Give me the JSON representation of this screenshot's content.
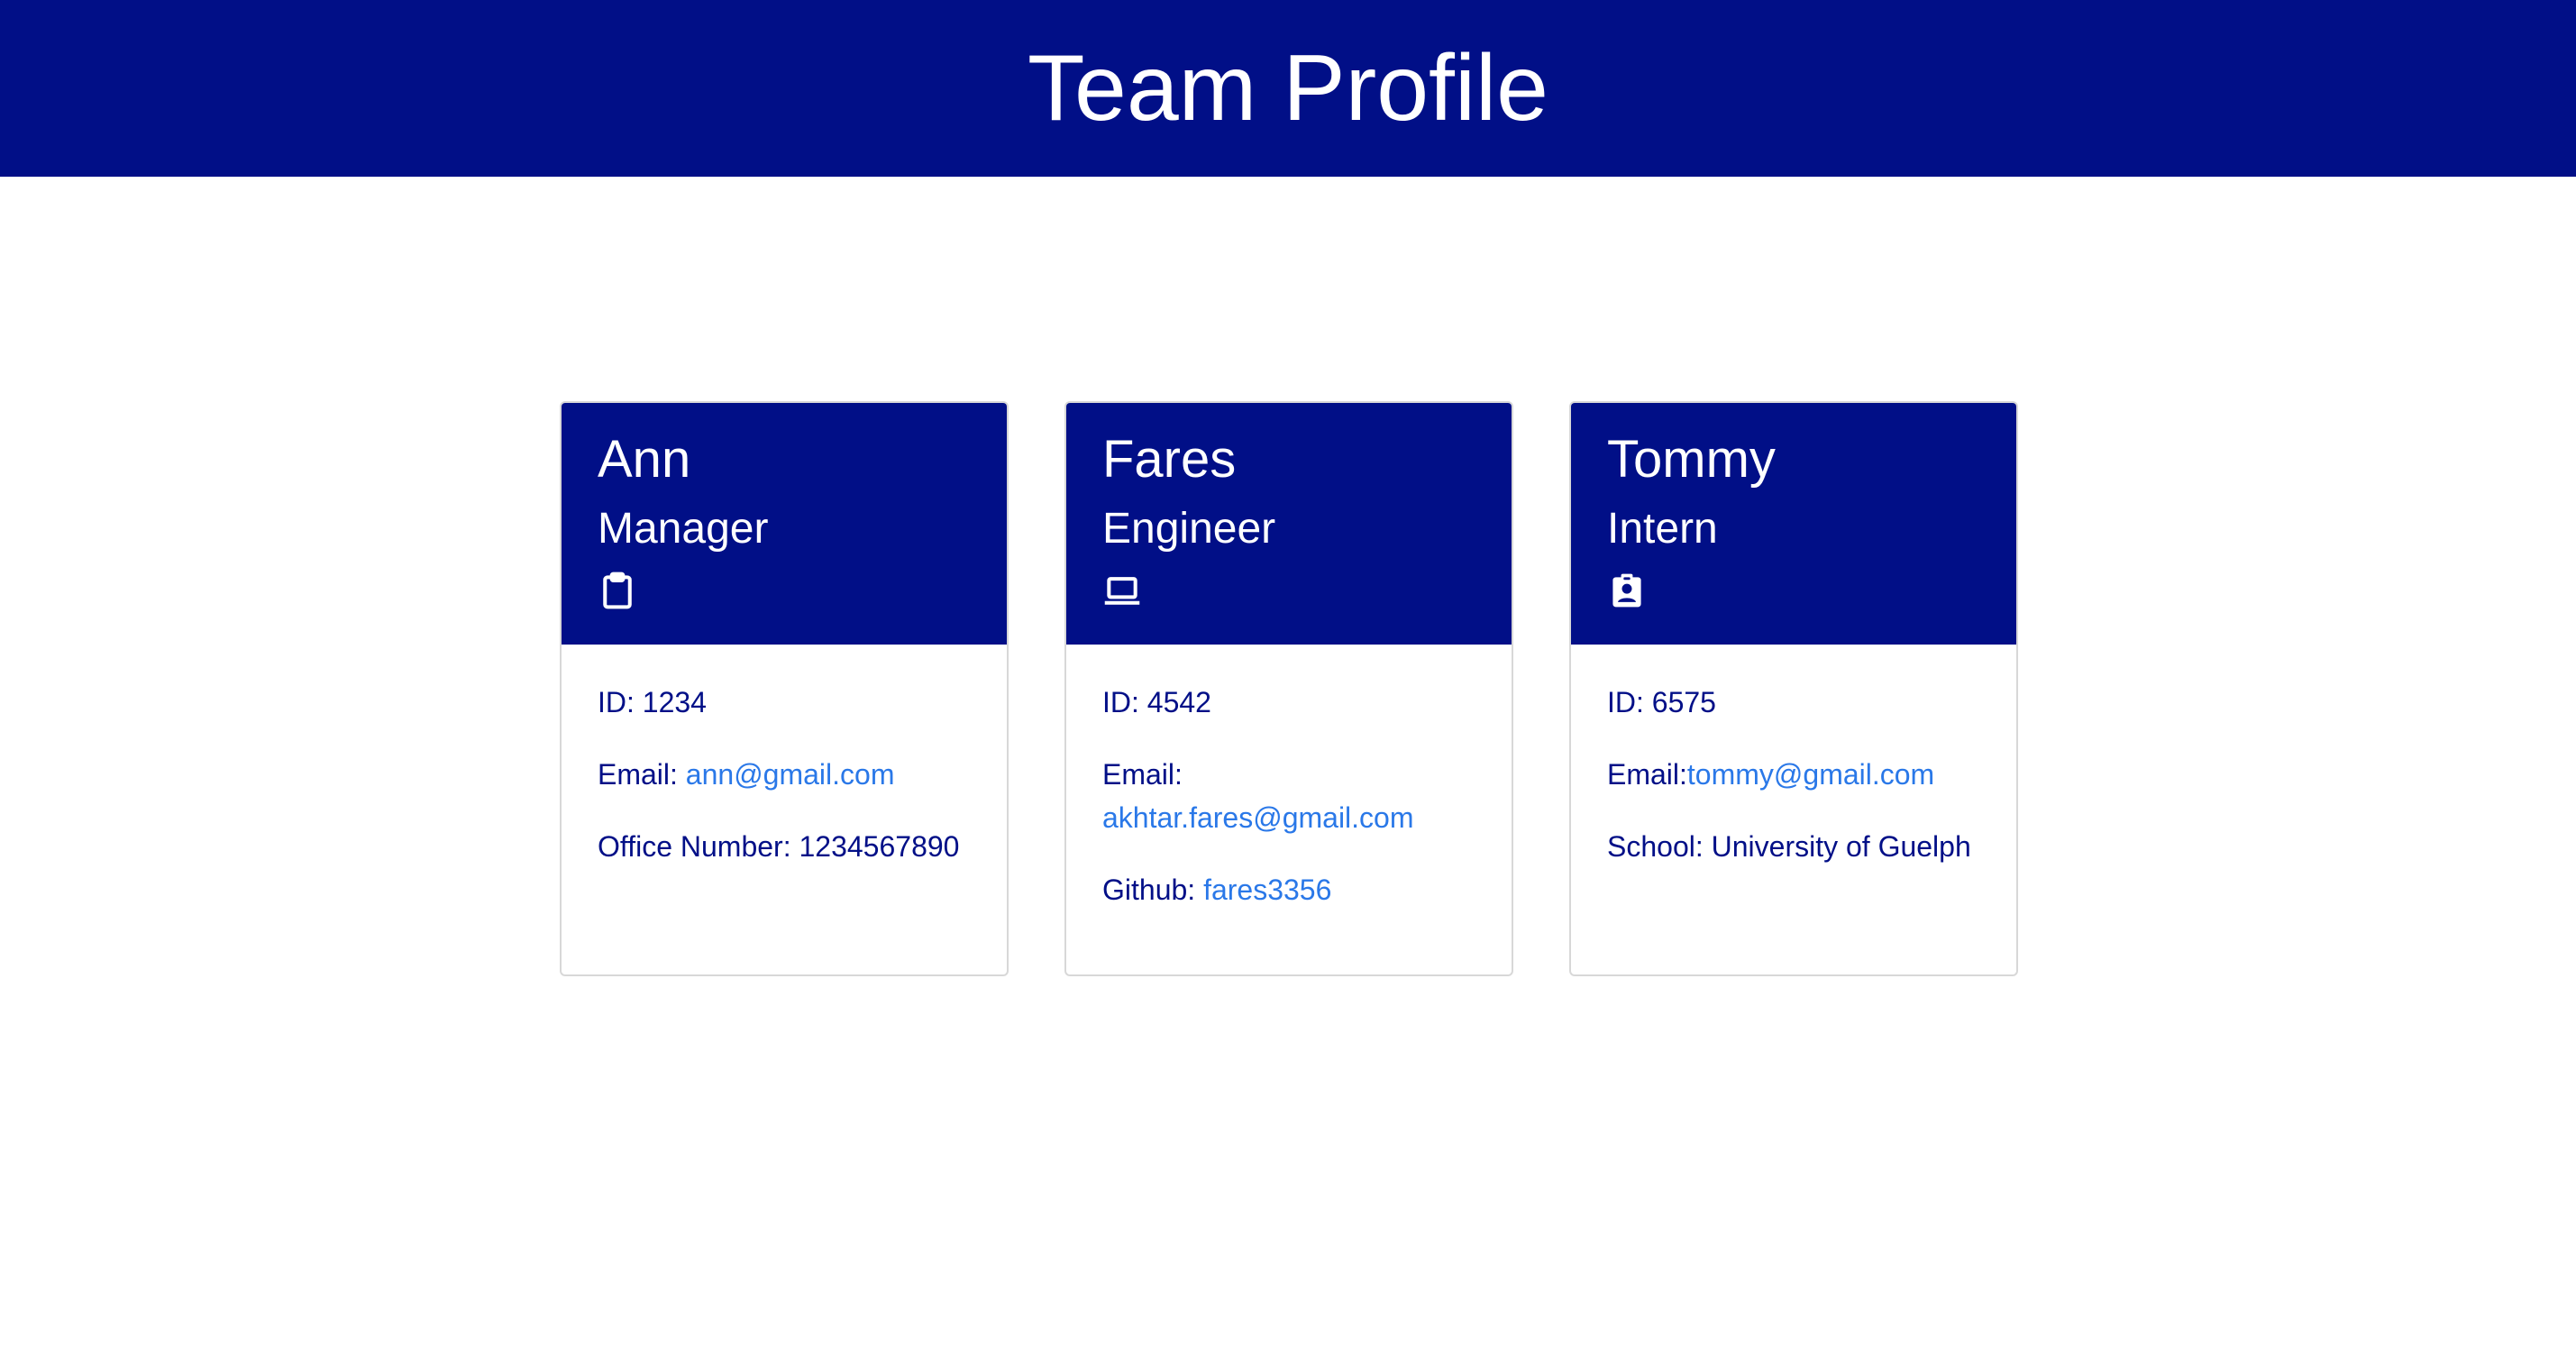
{
  "header": {
    "title": "Team Profile"
  },
  "colors": {
    "primary": "#010f87",
    "link": "#2a78e8",
    "text": "#010f87",
    "background": "#ffffff"
  },
  "members": [
    {
      "name": "Ann",
      "role": "Manager",
      "icon": "clipboard-icon",
      "id_label": "ID: ",
      "id": "1234",
      "email_label": "Email: ",
      "email": "ann@gmail.com",
      "extra_label": "Office Number: ",
      "extra_value": "1234567890"
    },
    {
      "name": "Fares",
      "role": "Engineer",
      "icon": "laptop-icon",
      "id_label": "ID: ",
      "id": "4542",
      "email_label": "Email: ",
      "email": "akhtar.fares@gmail.com",
      "extra_label": "Github: ",
      "extra_value": "fares3356"
    },
    {
      "name": "Tommy",
      "role": "Intern",
      "icon": "id-badge-icon",
      "id_label": "ID: ",
      "id": "6575",
      "email_label": "Email:",
      "email": "tommy@gmail.com",
      "extra_label": "School: ",
      "extra_value": "University of Guelph"
    }
  ]
}
